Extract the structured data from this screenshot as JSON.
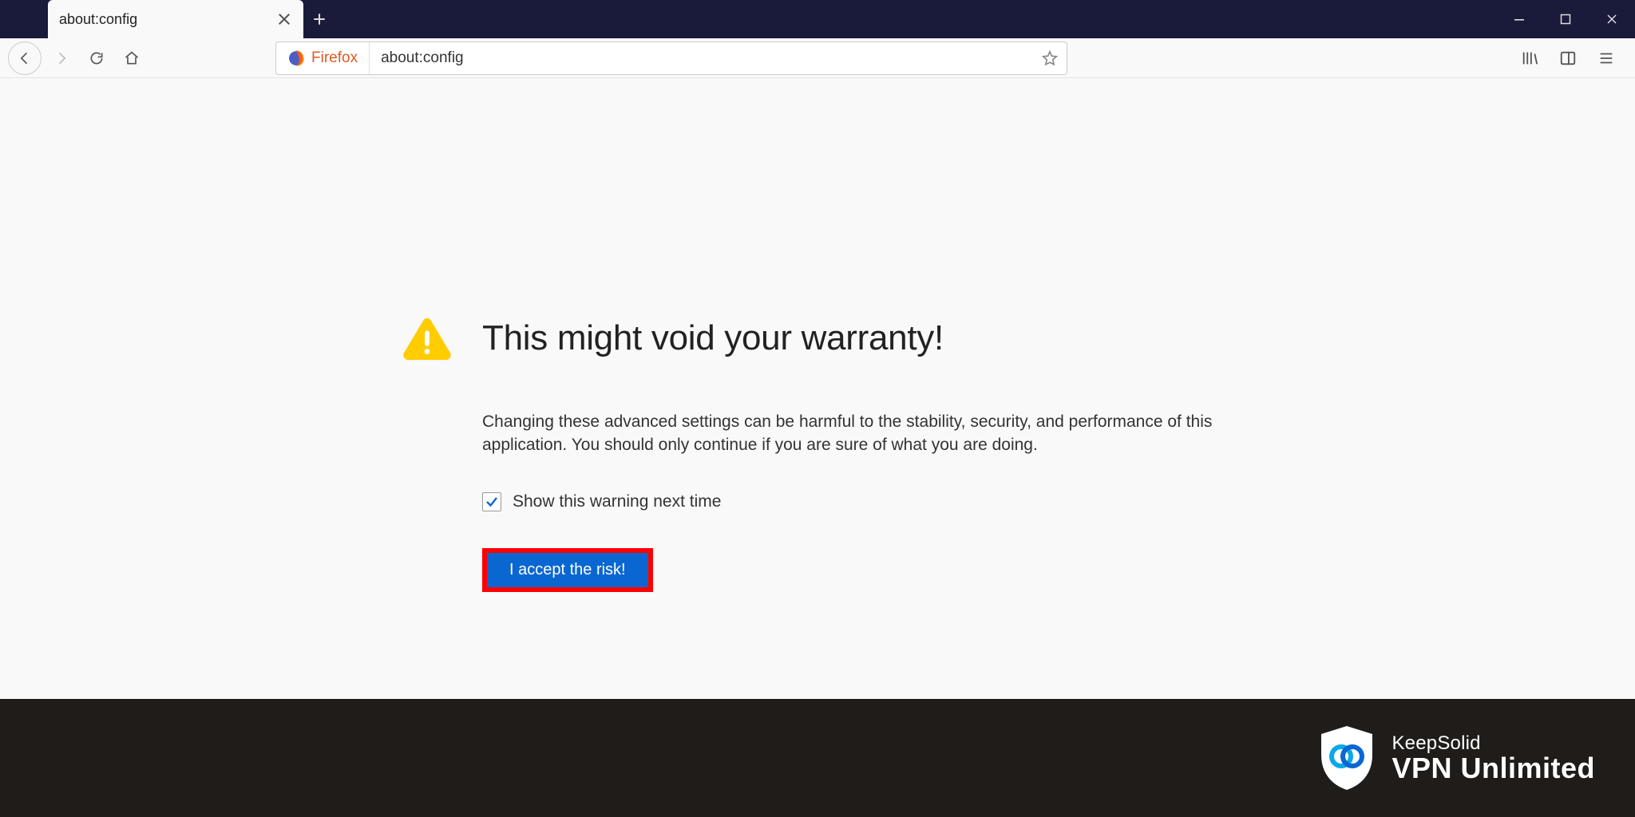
{
  "tab": {
    "title": "about:config"
  },
  "toolbar": {
    "identity_label": "Firefox",
    "url": "about:config"
  },
  "warning": {
    "title": "This might void your warranty!",
    "body": "Changing these advanced settings can be harmful to the stability, security, and performance of this application. You should only continue if you are sure of what you are doing.",
    "checkbox_label": "Show this warning next time",
    "accept_button": "I accept the risk!"
  },
  "footer": {
    "brand_top": "KeepSolid",
    "brand_bottom": "VPN Unlimited"
  }
}
